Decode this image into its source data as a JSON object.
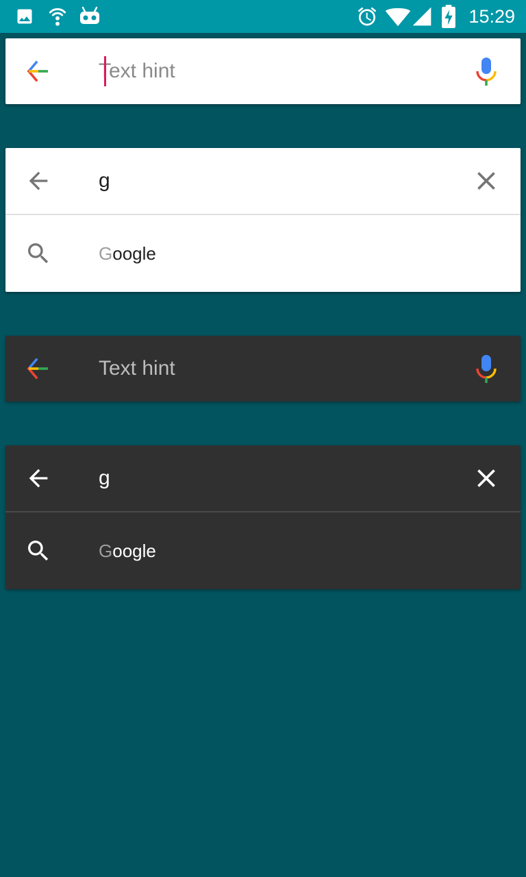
{
  "status_bar": {
    "time": "15:29",
    "left_icons": [
      "image-icon",
      "wifi-hotspot-icon",
      "android-debug-icon"
    ],
    "right_icons": [
      "alarm-icon",
      "wifi-icon",
      "signal-icon",
      "battery-charging-icon"
    ]
  },
  "cards": {
    "light_idle": {
      "hint": "Text hint"
    },
    "light_active": {
      "query": "g",
      "suggestion_first": "G",
      "suggestion_rest": "oogle"
    },
    "dark_idle": {
      "hint": "Text hint"
    },
    "dark_active": {
      "query": "g",
      "suggestion_first": "G",
      "suggestion_rest": "oogle"
    }
  },
  "colors": {
    "status_bar": "#0097A7",
    "background": "#02545F",
    "card_light": "#FFFFFF",
    "card_dark": "#303030",
    "cursor": "#D81B60",
    "google_blue": "#4285F4",
    "google_red": "#EA4335",
    "google_yellow": "#FBBC05",
    "google_green": "#34A853"
  }
}
